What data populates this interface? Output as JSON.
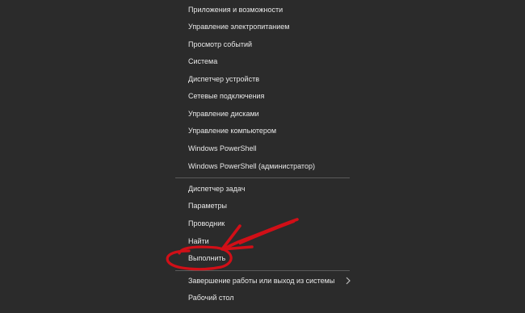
{
  "menu": {
    "group1": [
      {
        "label": "Приложения и возможности"
      },
      {
        "label": "Управление электропитанием"
      },
      {
        "label": "Просмотр событий"
      },
      {
        "label": "Система"
      },
      {
        "label": "Диспетчер устройств"
      },
      {
        "label": "Сетевые подключения"
      },
      {
        "label": "Управление дисками"
      },
      {
        "label": "Управление компьютером"
      },
      {
        "label": "Windows PowerShell"
      },
      {
        "label": "Windows PowerShell (администратор)"
      }
    ],
    "group2": [
      {
        "label": "Диспетчер задач"
      },
      {
        "label": "Параметры"
      },
      {
        "label": "Проводник"
      },
      {
        "label": "Найти"
      },
      {
        "label": "Выполнить"
      }
    ],
    "group3": [
      {
        "label": "Завершение работы или выход из системы",
        "has_submenu": true,
        "icon": "chevron-right-icon"
      },
      {
        "label": "Рабочий стол"
      }
    ]
  },
  "annotation": {
    "color": "#d10f17",
    "icon": "red-arrow-annotation"
  }
}
